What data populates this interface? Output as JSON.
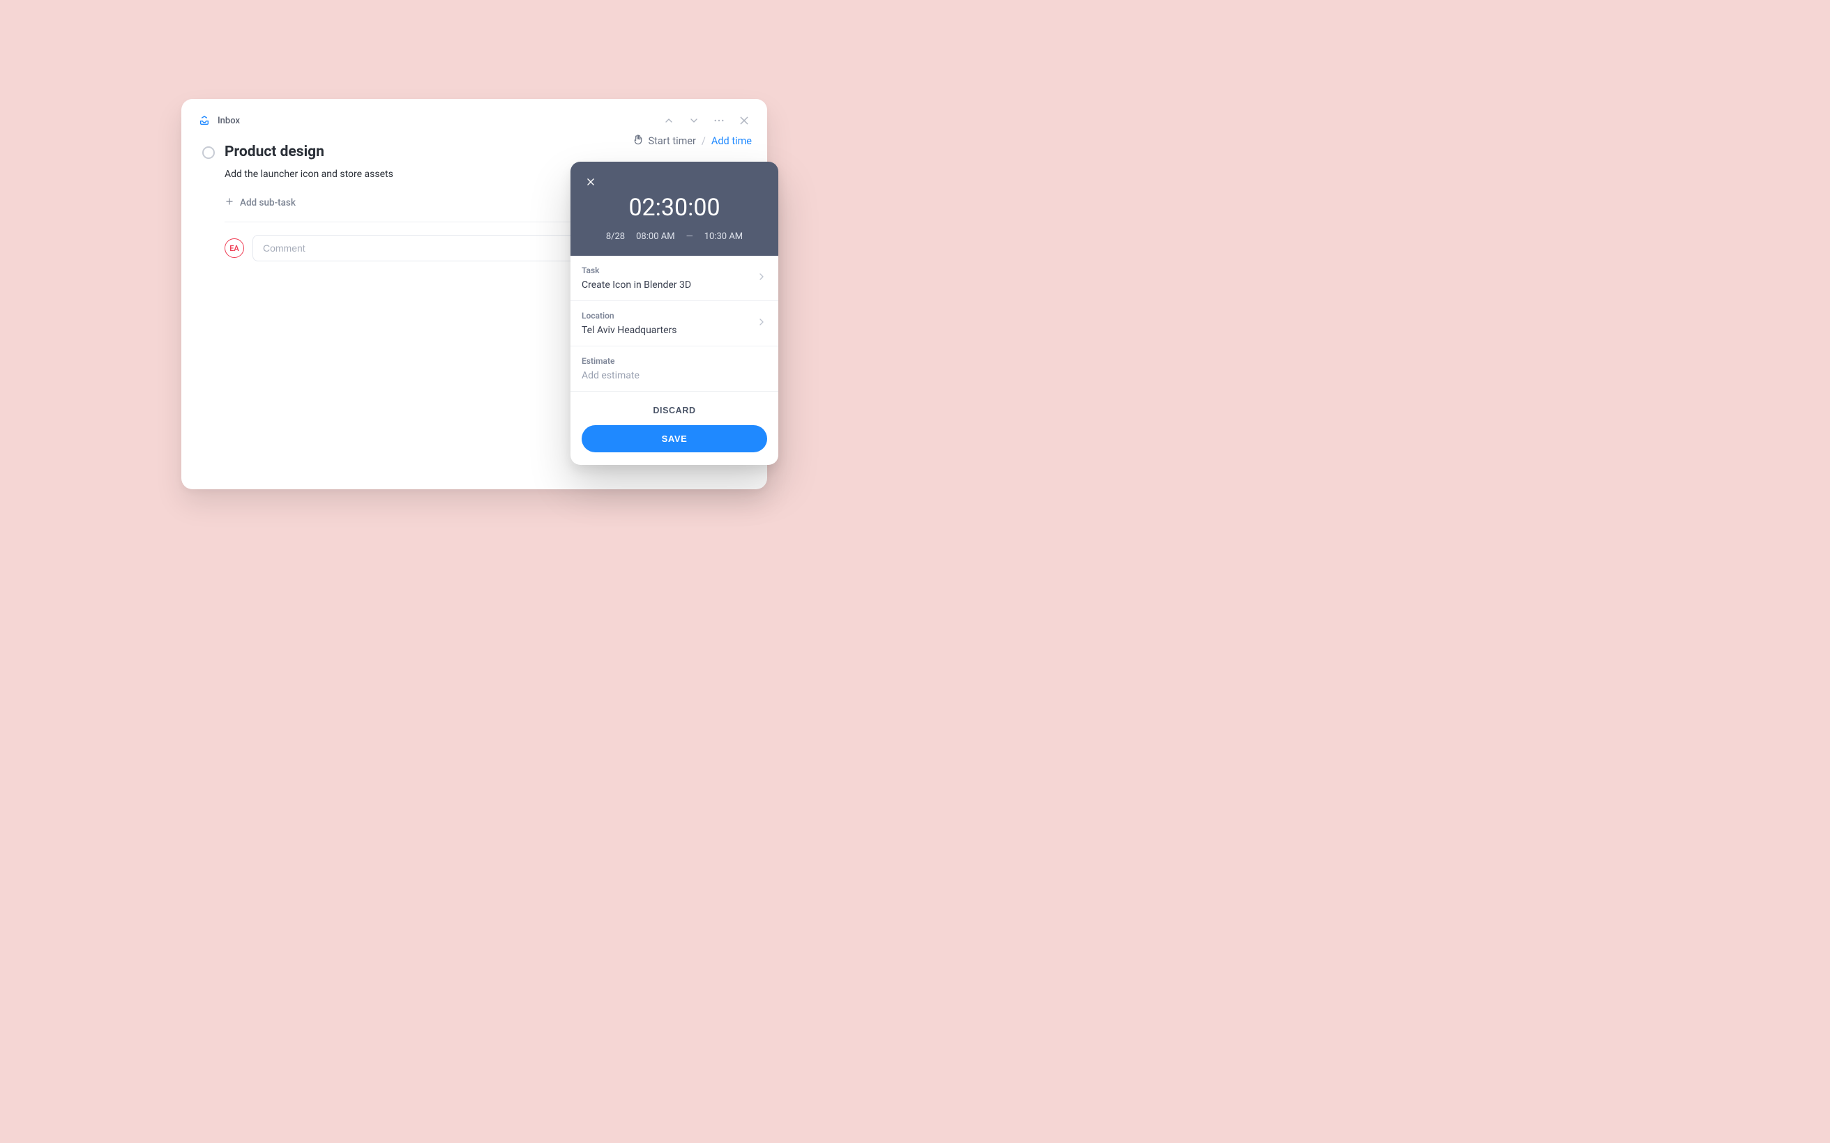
{
  "header": {
    "breadcrumb": "Inbox"
  },
  "task": {
    "title": "Product design",
    "description": "Add the launcher icon and store assets",
    "add_subtask_label": "Add sub-task",
    "avatar_initials": "EA",
    "comment_placeholder": "Comment"
  },
  "timer_bar": {
    "start_label": "Start timer",
    "separator": "/",
    "add_label": "Add time"
  },
  "time_panel": {
    "duration": "02:30:00",
    "date": "8/28",
    "start_time": "08:00 AM",
    "end_time": "10:30 AM",
    "task_label": "Task",
    "task_value": "Create Icon in Blender 3D",
    "location_label": "Location",
    "location_value": "Tel Aviv Headquarters",
    "estimate_label": "Estimate",
    "estimate_placeholder": "Add estimate",
    "discard_label": "DISCARD",
    "save_label": "SAVE"
  }
}
